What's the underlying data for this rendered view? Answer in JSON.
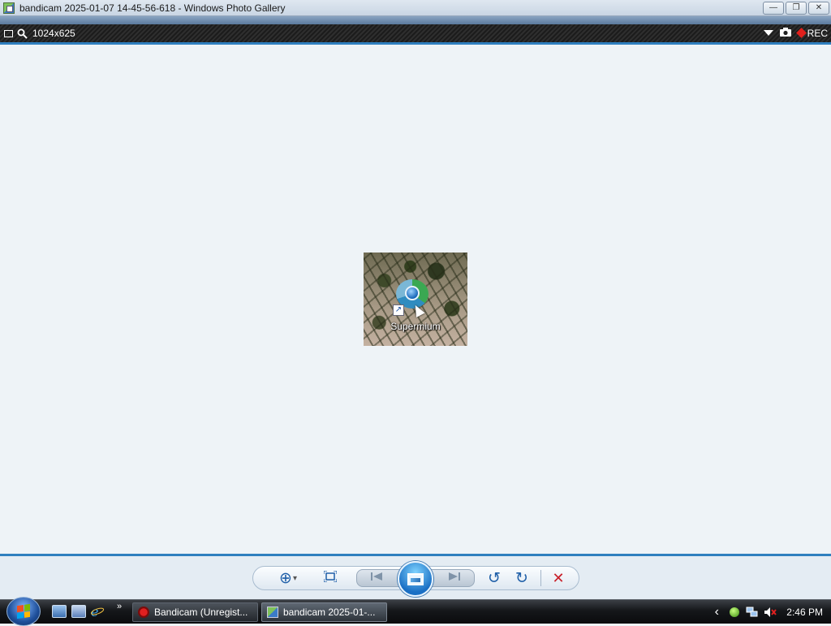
{
  "window": {
    "title": "bandicam 2025-01-07 14-45-56-618 - Windows Photo Gallery",
    "minimize": "—",
    "restore": "❐",
    "close": "✕"
  },
  "bandicam_bar": {
    "resolution": "1024x625",
    "rec_label": "REC",
    "rec_color": "#e0201c"
  },
  "photo": {
    "icon_label": "Supermium",
    "shortcut_glyph": "↗"
  },
  "controls": {
    "zoom": "⊕",
    "zoom_caret": "▾",
    "fit": "⛶",
    "previous": "⏮",
    "next": "⏭",
    "rotate_ccw": "↺",
    "rotate_cw": "↻",
    "delete": "✕",
    "delete_color": "#c8202a"
  },
  "taskbar": {
    "more_glyph": "»",
    "buttons": [
      {
        "label": "Bandicam (Unregist...",
        "icon": "bandicam-icon"
      },
      {
        "label": "bandicam 2025-01-...",
        "icon": "photo-gallery-icon"
      }
    ],
    "tray_arrow": "‹",
    "clock": "2:46 PM"
  },
  "colors": {
    "accent": "#2f7fbf",
    "viewer_bg": "#eef3f7"
  }
}
